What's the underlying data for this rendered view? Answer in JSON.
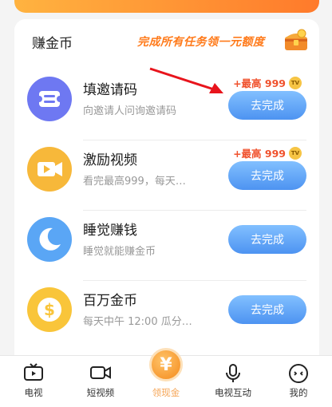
{
  "section": {
    "title": "赚金币",
    "promo": "完成所有任务领一元额度",
    "promo_icon": "treasure-chest-icon"
  },
  "tasks": [
    {
      "name": "填邀请码",
      "desc": "向邀请人问询邀请码",
      "reward": "+最高 999",
      "button": "去完成",
      "icon": "ticket-icon"
    },
    {
      "name": "激励视频",
      "desc": "看完最高999，每天…",
      "reward": "+最高 999",
      "button": "去完成",
      "icon": "video-icon"
    },
    {
      "name": "睡觉赚钱",
      "desc": "睡觉就能赚金币",
      "reward": "",
      "button": "去完成",
      "icon": "moon-icon"
    },
    {
      "name": "百万金币",
      "desc": "每天中午 12:00 瓜分…",
      "reward": "",
      "button": "去完成",
      "icon": "dollar-coin-icon"
    }
  ],
  "tabs": [
    {
      "label": "电视",
      "icon": "tv-icon"
    },
    {
      "label": "短视频",
      "icon": "video-camera-icon"
    },
    {
      "label": "领现金",
      "icon": "yuan-coin-icon"
    },
    {
      "label": "电视互动",
      "icon": "microphone-icon"
    },
    {
      "label": "我的",
      "icon": "profile-face-icon"
    }
  ],
  "colors": {
    "button_gradient": [
      "#82c0ff",
      "#4d93f1"
    ],
    "reward": "#f0512c",
    "promo": "#ff7a1a",
    "center_tab": "#f5a454"
  }
}
